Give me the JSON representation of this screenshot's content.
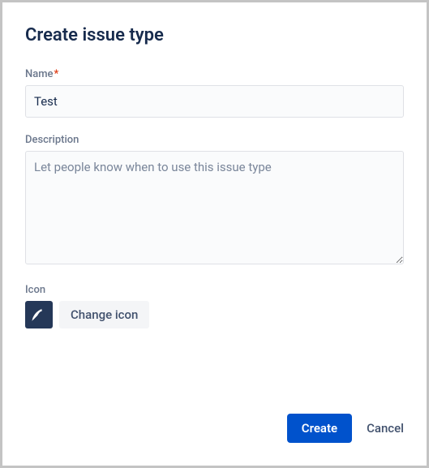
{
  "dialog": {
    "title": "Create issue type"
  },
  "form": {
    "name_label": "Name",
    "name_value": "Test",
    "description_label": "Description",
    "description_value": "",
    "description_placeholder": "Let people know when to use this issue type",
    "icon_label": "Icon",
    "change_icon_label": "Change icon"
  },
  "footer": {
    "create_label": "Create",
    "cancel_label": "Cancel"
  }
}
